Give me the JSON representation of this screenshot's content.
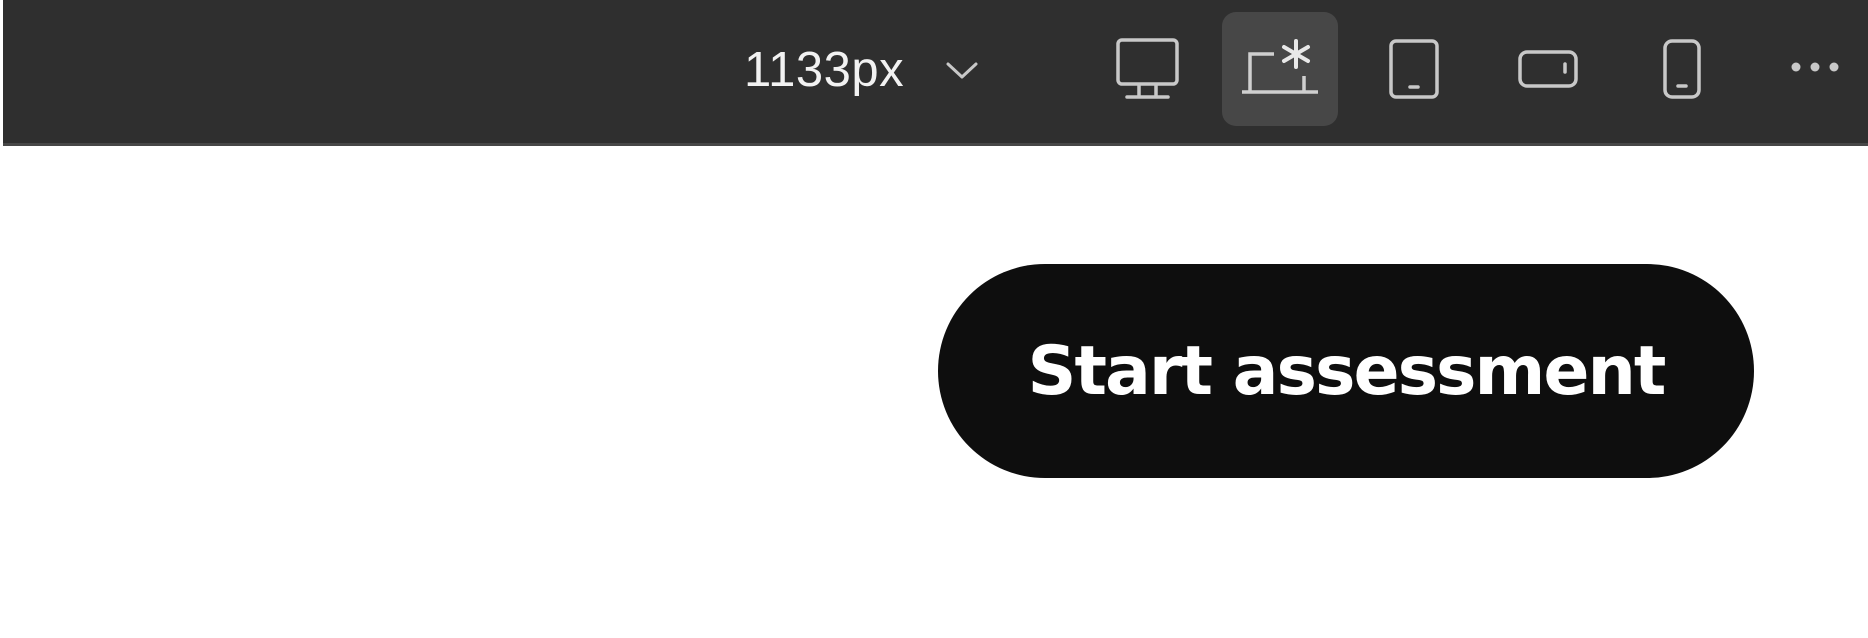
{
  "toolbar": {
    "breakpoint": {
      "value": "1133px",
      "dropdown_icon": "chevron-down-icon"
    },
    "devices": [
      {
        "icon": "desktop-icon",
        "active": false
      },
      {
        "icon": "laptop-primary-icon",
        "active": true
      },
      {
        "icon": "tablet-portrait-icon",
        "active": false
      },
      {
        "icon": "mobile-landscape-icon",
        "active": false
      },
      {
        "icon": "mobile-portrait-icon",
        "active": false
      }
    ],
    "more_icon": "more-horizontal-icon"
  },
  "main": {
    "cta_label": "Start assessment"
  },
  "colors": {
    "toolbar_bg": "#2f2f2f",
    "active_bg": "#474747",
    "icon_stroke": "#c8c8c8",
    "cta_bg": "#0e0e0e",
    "cta_text": "#ffffff",
    "page_bg": "#ffffff"
  }
}
